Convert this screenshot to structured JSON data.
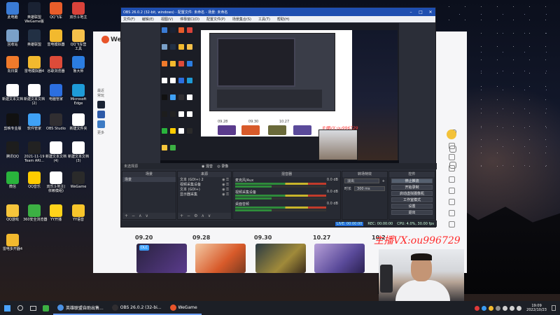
{
  "desktop": {
    "icons": [
      {
        "label": "此电脑",
        "color": "#3a7bd5"
      },
      {
        "label": "英雄联盟\nWeGame版",
        "color": "#1a2233"
      },
      {
        "label": "QQ飞车",
        "color": "#e85d2a"
      },
      {
        "label": "双乐斗地主",
        "color": "#d9423a"
      },
      {
        "label": "回收站",
        "color": "#7aa0c8"
      },
      {
        "label": "英雄联盟",
        "color": "#223044"
      },
      {
        "label": "雷电模拟器",
        "color": "#f2b92e"
      },
      {
        "label": "QQ飞车营\n工具",
        "color": "#f6c14b"
      },
      {
        "label": "向日葵",
        "color": "#f07a2b"
      },
      {
        "label": "雷电模拟器4",
        "color": "#f2b92e"
      },
      {
        "label": "谷歌浏览器",
        "color": "#dd4b39"
      },
      {
        "label": "鲁大师",
        "color": "#2b7de1"
      },
      {
        "label": "新建文本文档",
        "color": "#ffffff"
      },
      {
        "label": "新建文本文档\n(2)",
        "color": "#ffffff"
      },
      {
        "label": "电脑管家",
        "color": "#2c6fe0"
      },
      {
        "label": "Microsoft\nEdge",
        "color": "#1e9bd7"
      },
      {
        "label": "剪映专业版",
        "color": "#111111"
      },
      {
        "label": "软件管家",
        "color": "#3fa1f5"
      },
      {
        "label": "OBS Studio",
        "color": "#302e31"
      },
      {
        "label": "新建文件夹",
        "color": "#ffffff"
      },
      {
        "label": "腾讯QQ",
        "color": "#1d1d1d"
      },
      {
        "label": "2021-11-19\nTeam ARI...",
        "color": "#222222"
      },
      {
        "label": "新建文本文档\n(4)",
        "color": "#ffffff"
      },
      {
        "label": "新建文本文档\n(3)",
        "color": "#ffffff"
      },
      {
        "label": "微信",
        "color": "#29b33c"
      },
      {
        "label": "QQ音乐",
        "color": "#ffcc00"
      },
      {
        "label": "双乐斗地主(\n依赖模组)",
        "color": "#ffffff"
      },
      {
        "label": "WeGame",
        "color": "#2a2a2a"
      },
      {
        "label": "QQ游戏",
        "color": "#f6c53b"
      },
      {
        "label": "360安全浏览器",
        "color": "#3cb043"
      },
      {
        "label": "YY开播",
        "color": "#ffd31a"
      },
      {
        "label": "YY语音",
        "color": "#f7c52b"
      },
      {
        "label": "雷电多开器4",
        "color": "#f2b92e"
      }
    ]
  },
  "obs": {
    "title": "OBS 26.0.2 (32-bit, windows) - 配置文件: 未命名 - 场景: 未命名",
    "menu": [
      "文件(F)",
      "编辑(E)",
      "视图(V)",
      "停靠窗口(D)",
      "配置文件(P)",
      "场景集合(S)",
      "工具(T)",
      "帮助(H)"
    ],
    "mode_radios": [
      "混音",
      "录像"
    ],
    "docks": {
      "scenes": {
        "title": "场景",
        "items": [
          "场景"
        ]
      },
      "sources": {
        "title": "来源",
        "items": [
          "文本 (GDI+) 2",
          "视频采集设备",
          "文本 (GDI+)",
          "显示器采集"
        ]
      },
      "mixer": {
        "title": "混音器",
        "tracks": [
          {
            "name": "麦克风/Aux",
            "db": "0.0 dB"
          },
          {
            "name": "视频采集设备",
            "db": "0.0 dB"
          },
          {
            "name": "桌面音频",
            "db": "0.0 dB"
          }
        ]
      },
      "transitions": {
        "title": "转场特效",
        "type": "淡出",
        "duration_label": "时长",
        "duration_value": "300 ms"
      },
      "controls": {
        "title": "控件",
        "buttons": [
          "停止推流",
          "开始录制",
          "启动虚拟摄像机",
          "工作室模式",
          "设置",
          "退出"
        ]
      }
    },
    "dock_label": "未选择源",
    "status": {
      "live": "LIVE: 00:00:00",
      "rec": "REC: 00:00:00",
      "cpu": "CPU: 4.0%, 30.00 fps"
    },
    "preview_watermark": "主播VX:ou996729",
    "preview_dates": [
      "09.28",
      "09.30",
      "10.27"
    ]
  },
  "wegame": {
    "logo": "WeGame",
    "side_labels": [
      "最近",
      "常玩"
    ],
    "side_more": "更多",
    "dates": [
      "09.20",
      "09.28",
      "09.30",
      "10.27",
      "10.2"
    ],
    "poster_tag": "DLC"
  },
  "stream_watermark": "主播VX:ou996729",
  "taskbar": {
    "apps": [
      {
        "label": "英雄联盟自助出售...",
        "color": "#4a90e2"
      },
      {
        "label": "OBS 26.0.2 (32-bi...",
        "color": "#302e31"
      },
      {
        "label": "WeGame",
        "color": "#e8542a"
      }
    ],
    "time": "19:09",
    "date": "2022/10/23"
  }
}
